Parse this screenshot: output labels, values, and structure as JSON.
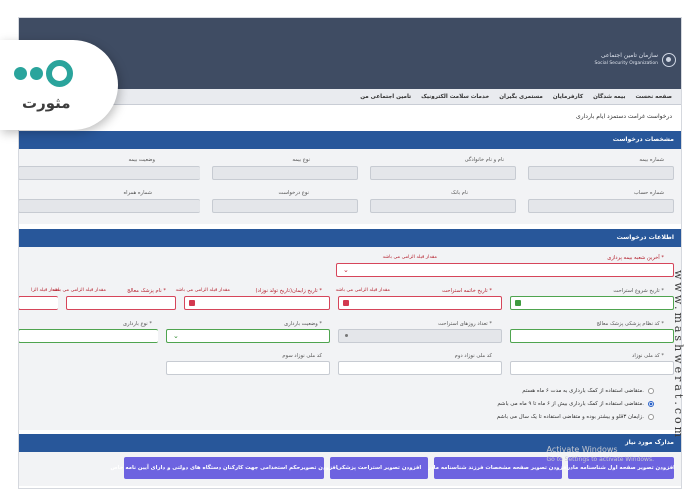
{
  "header": {
    "org_name_fa": "سازمان تامین اجتماعی",
    "org_name_en": "Social Security Organization"
  },
  "nav": {
    "items": [
      "صفحه نخست",
      "بیمه شدگان",
      "کارفرمایان",
      "مستمری بگیران",
      "خدمات سلامت الکترونیک",
      "تامین اجتماعی من"
    ]
  },
  "page": {
    "title": "درخواست غرامت دستمزد ایام بارداری"
  },
  "section1": {
    "title": "مشخصات درخواست",
    "row1": [
      {
        "label": "شماره بیمه"
      },
      {
        "label": "نام و نام خانوادگی"
      },
      {
        "label": "نوع بیمه"
      },
      {
        "label": "وضعیت بیمه"
      }
    ],
    "row2": [
      {
        "label": "شماره حساب"
      },
      {
        "label": "نام بانک"
      },
      {
        "label": "نوع درخواست"
      },
      {
        "label": "شماره همراه"
      }
    ]
  },
  "section2": {
    "title": "اطلاعات درخواست",
    "last_shift": {
      "label": "آخرین شعبه بیمه پردازی *",
      "error": "مقدار فیلد الزامی می باشد"
    },
    "dates": [
      {
        "label": "تاریخ شروع استراحت *",
        "error": ""
      },
      {
        "label": "تاریخ خاتمه استراحت *",
        "error": "مقدار فیلد الزامی می باشد"
      },
      {
        "label": "تاریخ زایمان(تاریخ تولد نوزاد) *",
        "error": "مقدار فیلد الزامی می باشد"
      },
      {
        "label": "نام پزشک معالج *",
        "error": "مقدار فیلد الزامی می باشد"
      },
      {
        "label": "",
        "error": "مقدار فیلد الزا"
      }
    ],
    "row4": [
      {
        "label": "کد نظام پزشکی پزشک معالج *"
      },
      {
        "label": "تعداد روزهای استراحت *"
      },
      {
        "label": "وضعیت بارداری *"
      },
      {
        "label": "نوع بارداری *"
      }
    ],
    "row5": [
      {
        "label": "کد ملی نوزاد *"
      },
      {
        "label": "کد ملی نوزاد دوم"
      },
      {
        "label": "کد ملی نوزاد سوم"
      }
    ],
    "options": [
      {
        "text": "متقاضی استفاده از کمک بارداری به مدت ۶ ماه هستم.",
        "selected": false
      },
      {
        "text": "متقاضی استفاده از کمک بارداری بیش از ۶ ماه تا ۹ ماه می باشم.",
        "selected": true
      },
      {
        "text": "زایمان ۳قلو و بیشتر بوده و متقاضی استفاده تا یک سال می باشم.",
        "selected": false
      }
    ]
  },
  "section3": {
    "title": "مدارک مورد نیاز",
    "buttons": [
      "افزودن تصویر صفحه اول شناسنامه مادر",
      "افزودن تصویر صفحه مشخصات فرزند شناسنامه مادر",
      "افزودن تصویر استراحت پزشکی",
      "افزودن تصویرحکم استخدامی جهت کارکنان دستگاه های دولتی و دارای آیین نامه خاص"
    ]
  },
  "watermark": {
    "line1": "Activate Windows",
    "line2": "Go to Settings to activate Windows."
  },
  "overlay": {
    "logo_word": "مثورت",
    "side_url": "www.mashwerat.com"
  },
  "colors": {
    "header_bg": "#3f4c63",
    "section_bg": "#28579a",
    "button_bg": "#6d63e0",
    "error": "#d6455a",
    "valid": "#4fa44f",
    "logo": "#2aa49c"
  }
}
